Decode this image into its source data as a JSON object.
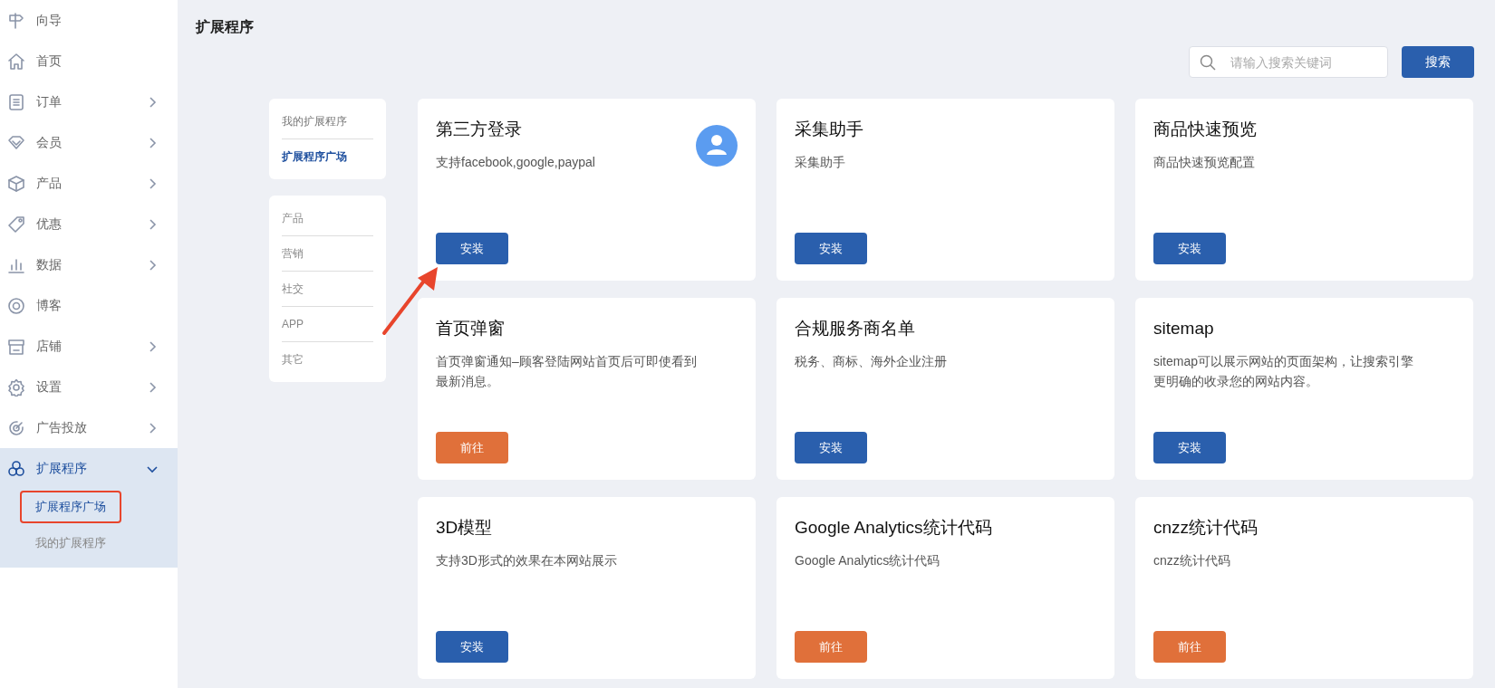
{
  "sidebar": {
    "items": [
      {
        "label": "向导",
        "has_children": false,
        "expanded": false
      },
      {
        "label": "首页",
        "has_children": false,
        "expanded": false
      },
      {
        "label": "订单",
        "has_children": true,
        "expanded": false
      },
      {
        "label": "会员",
        "has_children": true,
        "expanded": false
      },
      {
        "label": "产品",
        "has_children": true,
        "expanded": false
      },
      {
        "label": "优惠",
        "has_children": true,
        "expanded": false
      },
      {
        "label": "数据",
        "has_children": true,
        "expanded": false
      },
      {
        "label": "博客",
        "has_children": false,
        "expanded": false
      },
      {
        "label": "店铺",
        "has_children": true,
        "expanded": false
      },
      {
        "label": "设置",
        "has_children": true,
        "expanded": false
      },
      {
        "label": "广告投放",
        "has_children": true,
        "expanded": false
      },
      {
        "label": "扩展程序",
        "has_children": true,
        "expanded": true,
        "children": [
          {
            "label": "扩展程序广场",
            "selected": true,
            "highlighted": true
          },
          {
            "label": "我的扩展程序",
            "selected": false,
            "highlighted": false
          }
        ]
      }
    ]
  },
  "page": {
    "title": "扩展程序"
  },
  "search": {
    "placeholder": "请输入搜索关键词",
    "button": "搜索"
  },
  "nav": {
    "tabs": [
      {
        "label": "我的扩展程序",
        "selected": false
      },
      {
        "label": "扩展程序广场",
        "selected": true
      }
    ],
    "categories": [
      "产品",
      "营销",
      "社交",
      "APP",
      "其它"
    ]
  },
  "cards": [
    {
      "title": "第三方登录",
      "description": "支持facebook,google,paypal",
      "avatar": true,
      "button": {
        "label": "安装",
        "kind": "install"
      }
    },
    {
      "title": "采集助手",
      "description": "采集助手",
      "avatar": false,
      "button": {
        "label": "安装",
        "kind": "install"
      }
    },
    {
      "title": "商品快速预览",
      "description": "商品快速预览配置",
      "avatar": false,
      "button": {
        "label": "安装",
        "kind": "install"
      }
    },
    {
      "title": "首页弹窗",
      "description": "首页弹窗通知–顾客登陆网站首页后可即使看到最新消息。",
      "avatar": false,
      "button": {
        "label": "前往",
        "kind": "go"
      }
    },
    {
      "title": "合规服务商名单",
      "description": "税务、商标、海外企业注册",
      "avatar": false,
      "button": {
        "label": "安装",
        "kind": "install"
      }
    },
    {
      "title": "sitemap",
      "description": "sitemap可以展示网站的页面架构，让搜索引擎更明确的收录您的网站内容。",
      "avatar": false,
      "button": {
        "label": "安装",
        "kind": "install"
      }
    },
    {
      "title": "3D模型",
      "description": "支持3D形式的效果在本网站展示",
      "avatar": false,
      "button": {
        "label": "安装",
        "kind": "install"
      }
    },
    {
      "title": "Google Analytics统计代码",
      "description": "Google Analytics统计代码",
      "avatar": false,
      "button": {
        "label": "前往",
        "kind": "go"
      }
    },
    {
      "title": "cnzz统计代码",
      "description": "cnzz统计代码",
      "avatar": false,
      "button": {
        "label": "前往",
        "kind": "go"
      }
    }
  ]
}
